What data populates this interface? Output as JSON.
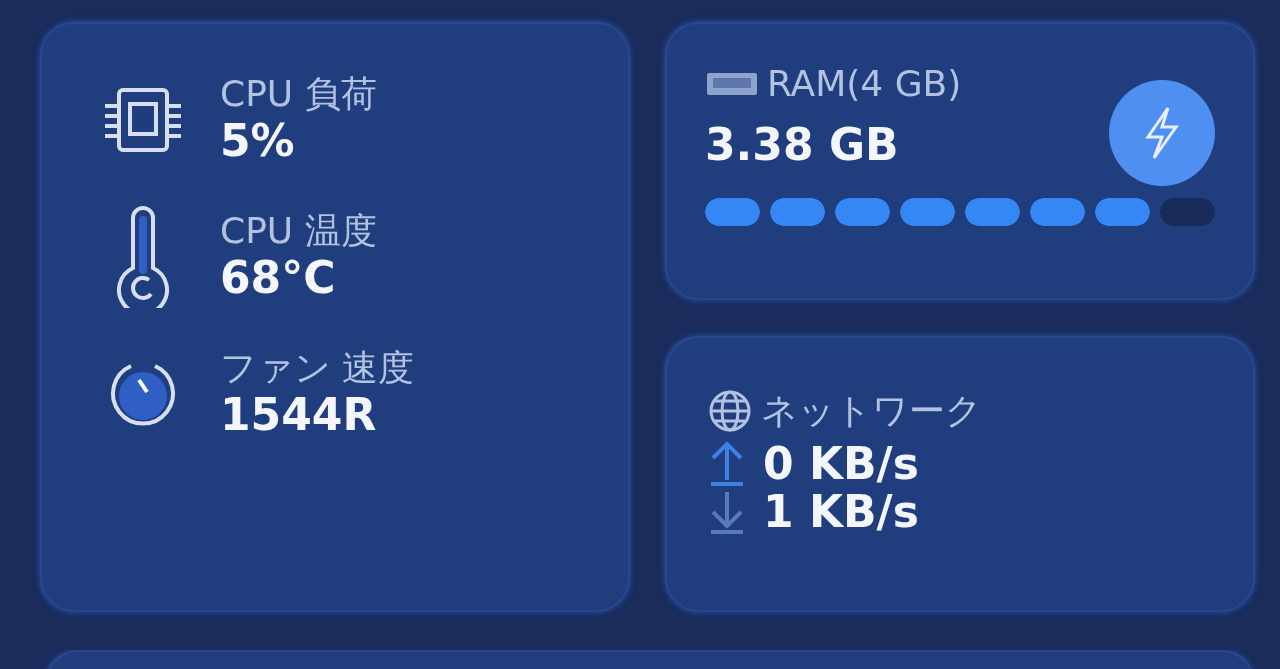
{
  "system_metrics": [
    {
      "kind": "cpu",
      "label": "CPU 負荷",
      "value": "5%"
    },
    {
      "kind": "temperature",
      "label": "CPU 温度",
      "value": "68°C"
    },
    {
      "kind": "fan",
      "label": "ファン 速度",
      "value": "1544R"
    }
  ],
  "ram": {
    "label": "RAM(4 GB)",
    "value": "3.38 GB",
    "level": 0.875
  },
  "network": {
    "label": "ネットワーク",
    "rates": [
      {
        "kind": "upload",
        "value": "0 KB/s"
      },
      {
        "kind": "download",
        "value": "1 KB/s"
      }
    ]
  }
}
